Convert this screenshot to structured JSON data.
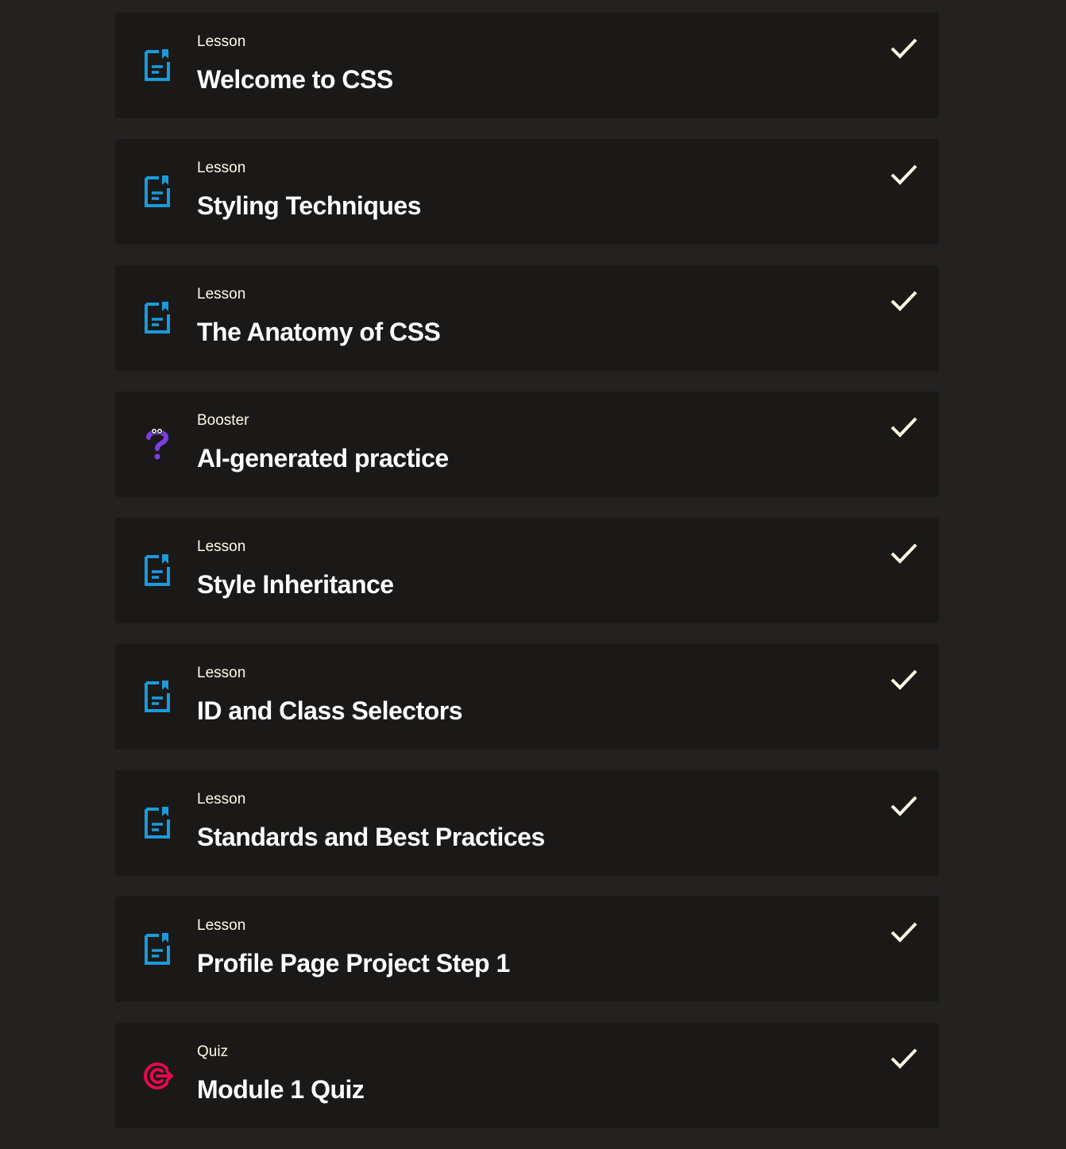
{
  "items": [
    {
      "type": "Lesson",
      "title": "Welcome to CSS",
      "icon": "lesson-icon",
      "completed": true
    },
    {
      "type": "Lesson",
      "title": "Styling Techniques",
      "icon": "lesson-icon",
      "completed": true
    },
    {
      "type": "Lesson",
      "title": "The Anatomy of CSS",
      "icon": "lesson-icon",
      "completed": true
    },
    {
      "type": "Booster",
      "title": "AI-generated practice",
      "icon": "question-icon",
      "completed": true
    },
    {
      "type": "Lesson",
      "title": "Style Inheritance",
      "icon": "lesson-icon",
      "completed": true
    },
    {
      "type": "Lesson",
      "title": "ID and Class Selectors",
      "icon": "lesson-icon",
      "completed": true
    },
    {
      "type": "Lesson",
      "title": "Standards and Best Practices",
      "icon": "lesson-icon",
      "completed": true
    },
    {
      "type": "Lesson",
      "title": "Profile Page Project Step 1",
      "icon": "lesson-icon",
      "completed": true
    },
    {
      "type": "Quiz",
      "title": "Module 1 Quiz",
      "icon": "target-icon",
      "completed": true
    }
  ],
  "colors": {
    "page_bg": "#232221",
    "card_bg": "#1a1918",
    "lesson_icon": "#1a9bdc",
    "booster_icon": "#7b3fe4",
    "quiz_icon": "#e5094f",
    "check": "#fffbe5"
  }
}
